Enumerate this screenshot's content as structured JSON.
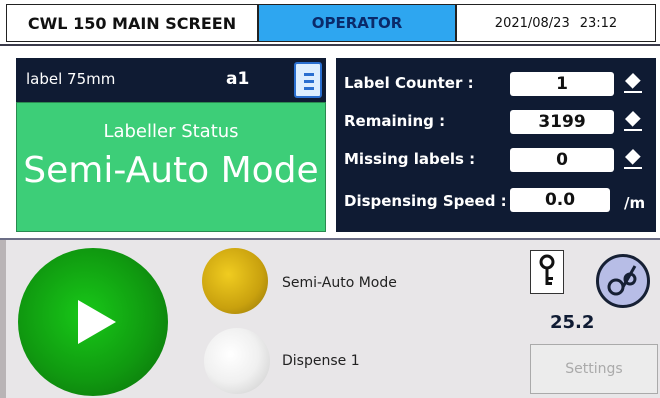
{
  "header": {
    "title": "CWL 150 MAIN SCREEN",
    "user": "OPERATOR",
    "date": "2021/08/23",
    "time": "23:12"
  },
  "label": {
    "name": "label 75mm",
    "code": "a1"
  },
  "status": {
    "heading": "Labeller Status",
    "mode": "Semi-Auto Mode"
  },
  "counters": {
    "label_counter_label": "Label Counter :",
    "label_counter_value": "1",
    "remaining_label": "Remaining :",
    "remaining_value": "3199",
    "missing_label": "Missing labels :",
    "missing_value": "0",
    "speed_label": "Dispensing Speed :",
    "speed_value": "0.0",
    "speed_unit": "/m"
  },
  "indicators": {
    "mode_text": "Semi-Auto Mode",
    "dispense_text": "Dispense 1"
  },
  "right_panel": {
    "speed_value": "25.2",
    "settings_label": "Settings"
  },
  "colors": {
    "header_operator_bg": "#2ea6f0",
    "panel_dark": "#0f1b33",
    "status_green": "#3dce78",
    "start_button": "#109a10",
    "mode_lamp": "#c9a10e"
  }
}
